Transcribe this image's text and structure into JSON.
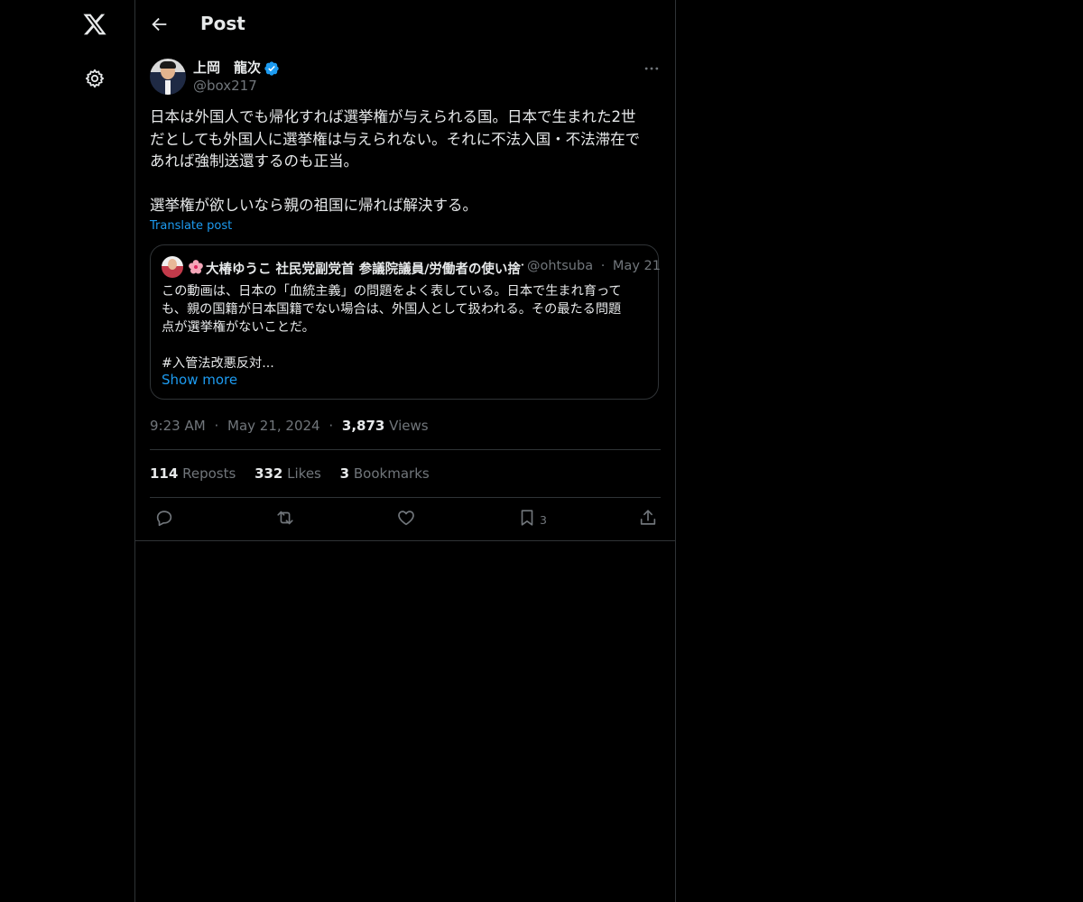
{
  "nav": {
    "logo_icon": "x-logo-icon",
    "settings_icon": "gear-icon"
  },
  "header": {
    "title": "Post",
    "back_icon": "arrow-left-icon"
  },
  "post": {
    "author_name": "上岡　龍次",
    "handle": "@box217",
    "verified": true,
    "text": "日本は外国人でも帰化すれば選挙権が与えられる国。日本で生まれた2世\nだとしても外国人に選挙権は与えられない。それに不法入国・不法滞在で\nあれば強制送還するのも正当。\n\n選挙権が欲しいなら親の祖国に帰れば解決する。",
    "translate_label": "Translate post",
    "quote": {
      "author_name": "大椿ゆうこ 社民党副党首 参議院議員/労働者の使い捨て",
      "handle": "@ohtsuba",
      "separator": "·",
      "date": "May 21",
      "text": "この動画は、日本の「血統主義」の問題をよく表している。日本で生まれ育って\nも、親の国籍が日本国籍でない場合は、外国人として扱われる。その最たる問題\n点が選挙権がないことだ。\n\n#入管法改悪反対...",
      "show_more": "Show more"
    },
    "time": "9:23 AM",
    "dot": "·",
    "date": "May 21, 2024",
    "views_count": "3,873",
    "views_label": "Views",
    "stats": {
      "reposts_count": "114",
      "reposts_label": "Reposts",
      "likes_count": "332",
      "likes_label": "Likes",
      "bookmarks_count": "3",
      "bookmarks_label": "Bookmarks"
    },
    "actions": {
      "bookmark_count": "3"
    }
  },
  "colors": {
    "background": "#000000",
    "text": "#e7e9ea",
    "muted": "#71767b",
    "accent": "#1d9bf0",
    "border": "#2f3336"
  }
}
